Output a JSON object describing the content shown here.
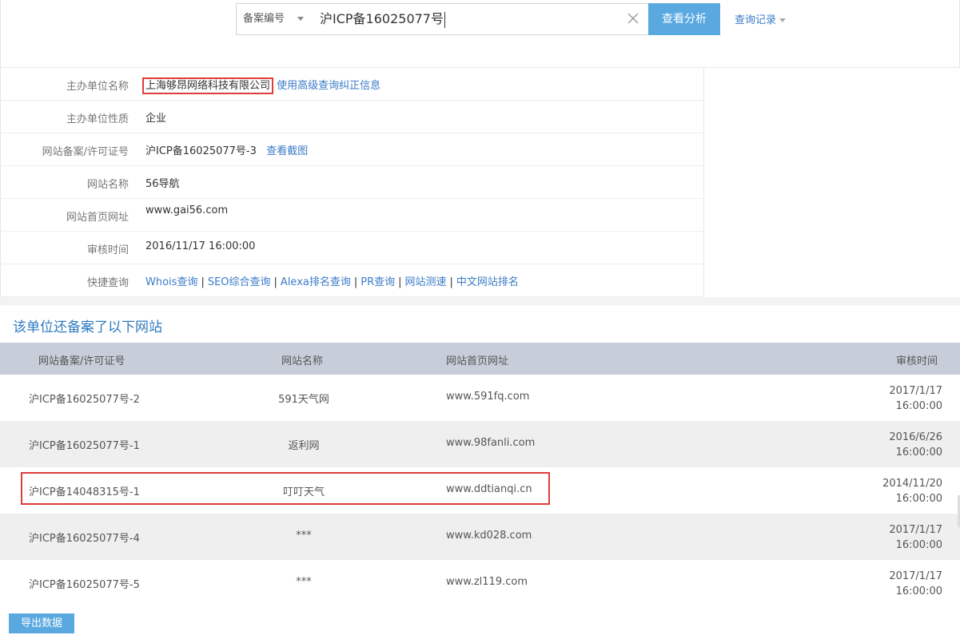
{
  "search": {
    "type_label": "备案编号",
    "query": "沪ICP备16025077号",
    "submit_label": "查看分析",
    "history_label": "查询记录"
  },
  "info": {
    "rows": [
      {
        "label": "主办单位名称",
        "value": "上海够昂网络科技有限公司",
        "extra_link": "使用高级查询纠正信息"
      },
      {
        "label": "主办单位性质",
        "value": "企业"
      },
      {
        "label": "网站备案/许可证号",
        "value": "沪ICP备16025077号-3",
        "extra_link": "查看截图"
      },
      {
        "label": "网站名称",
        "value": "56导航"
      },
      {
        "label": "网站首页网址",
        "value": "www.gai56.com"
      },
      {
        "label": "审核时间",
        "value": "2016/11/17 16:00:00"
      },
      {
        "label": "快捷查询",
        "links": [
          "Whois查询",
          "SEO综合查询",
          "Alexa排名查询",
          "PR查询",
          "网站测速",
          "中文网站排名"
        ]
      }
    ]
  },
  "other_sites": {
    "title": "该单位还备案了以下网站",
    "headers": [
      "网站备案/许可证号",
      "网站名称",
      "网站首页网址",
      "审核时间"
    ],
    "rows": [
      {
        "license": "沪ICP备16025077号-2",
        "name": "591天气网",
        "url": "www.591fq.com",
        "date": "2017/1/17",
        "time": "16:00:00"
      },
      {
        "license": "沪ICP备16025077号-1",
        "name": "返利网",
        "url": "www.98fanli.com",
        "date": "2016/6/26",
        "time": "16:00:00"
      },
      {
        "license": "沪ICP备14048315号-1",
        "name": "叮叮天气",
        "url": "www.ddtianqi.cn",
        "date": "2014/11/20",
        "time": "16:00:00"
      },
      {
        "license": "沪ICP备16025077号-4",
        "name": "***",
        "url": "www.kd028.com",
        "date": "2017/1/17",
        "time": "16:00:00"
      },
      {
        "license": "沪ICP备16025077号-5",
        "name": "***",
        "url": "www.zl119.com",
        "date": "2017/1/17",
        "time": "16:00:00"
      }
    ]
  },
  "export_label": "导出数据",
  "colors": {
    "accent": "#5aa8e0",
    "link": "#3a7bc8",
    "highlight": "#e03c3c",
    "header_bg": "#c8ced9"
  }
}
